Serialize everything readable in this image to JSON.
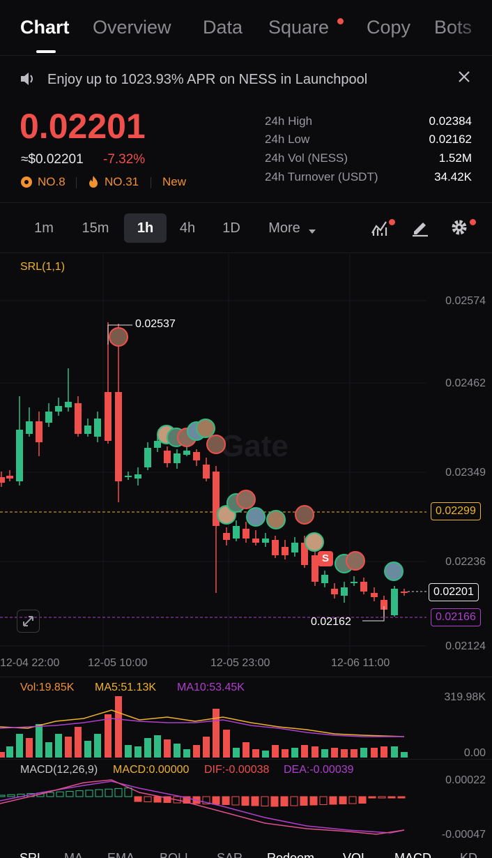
{
  "nav": {
    "tabs": [
      "Chart",
      "Overview",
      "Data",
      "Square",
      "Copy",
      "Bots"
    ],
    "active": "Chart"
  },
  "banner": {
    "text": "Enjoy up to 1023.93% APR on NESS in Launchpool",
    "speaker_icon": "speaker-icon",
    "close_icon": "close-icon"
  },
  "ticker": {
    "price": "0.02201",
    "approx_usd": "≈$0.02201",
    "change": "-7.32%",
    "rank1": "NO.8",
    "rank2": "NO.31",
    "tag": "New",
    "stats": [
      {
        "label": "24h High",
        "value": "0.02384"
      },
      {
        "label": "24h Low",
        "value": "0.02162"
      },
      {
        "label": "24h Vol (NESS)",
        "value": "1.52M"
      },
      {
        "label": "24h Turnover (USDT)",
        "value": "34.42K"
      }
    ]
  },
  "intervals": {
    "items": [
      "1m",
      "15m",
      "1h",
      "4h",
      "1D"
    ],
    "active": "1h",
    "more": "More"
  },
  "toolbar": {
    "icons": [
      "indicator-icon",
      "draw-icon",
      "settings-icon"
    ]
  },
  "chart": {
    "indicator": "SRL(1,1)",
    "watermark": "Gate",
    "price_axis": [
      "0.02574",
      "0.02462",
      "0.02349",
      "0.02236",
      "0.02124"
    ],
    "time_axis": [
      "12-04 22:00",
      "12-05 10:00",
      "12-05 23:00",
      "12-06 11:00"
    ],
    "high_label": "0.02537",
    "low_label": "0.02162",
    "level_yellow": "0.02299",
    "level_current": "0.02201",
    "level_purple": "0.02166",
    "trade_marker": "S",
    "expand_icon": "expand-icon",
    "colors": {
      "up": "#2fbd85",
      "down": "#f0504c",
      "yellow": "#f0b429",
      "purple": "#b03fcf"
    }
  },
  "volume": {
    "vol": "Vol:19.85K",
    "ma5": "MA5:51.13K",
    "ma10": "MA10:53.45K",
    "axis_top": "319.98K",
    "axis_bottom": "0.00"
  },
  "macd": {
    "title": "MACD(12,26,9)",
    "macd": "MACD:0.00000",
    "dif": "DIF:-0.00038",
    "dea": "DEA:-0.00039",
    "axis_top": "0.00022",
    "axis_bottom": "-0.00047"
  },
  "indicator_tabs": [
    "SRL",
    "MA",
    "EMA",
    "BOLL",
    "SAR",
    "Redeem",
    "VOL",
    "MACD",
    "KD"
  ]
}
